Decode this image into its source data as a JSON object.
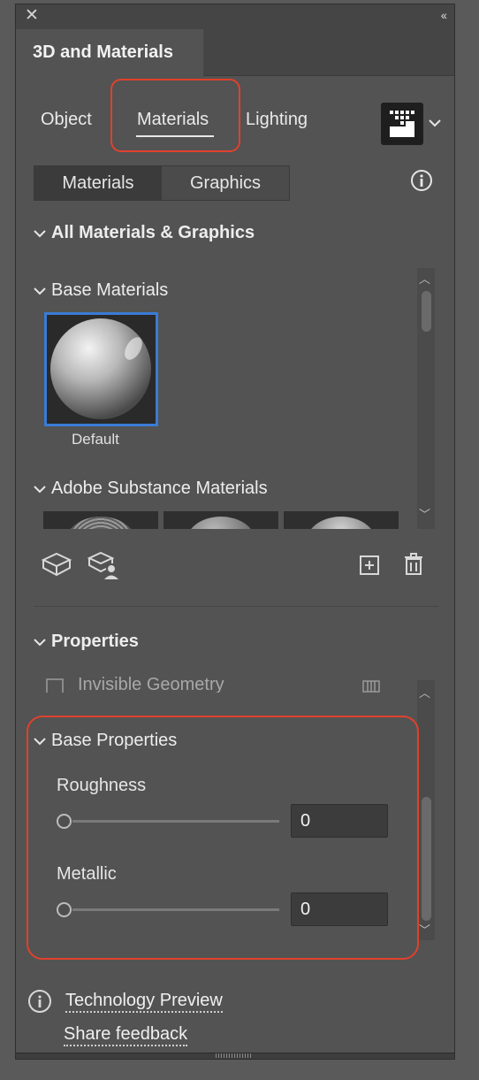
{
  "window": {
    "title": "3D and Materials"
  },
  "tabs": [
    {
      "label": "Object"
    },
    {
      "label": "Materials"
    },
    {
      "label": "Lighting"
    }
  ],
  "toggle": {
    "materials": "Materials",
    "graphics": "Graphics"
  },
  "sections": {
    "all": "All Materials & Graphics",
    "base_materials": "Base Materials",
    "substance": "Adobe Substance Materials",
    "properties": "Properties",
    "invisible_geometry": "Invisible Geometry",
    "base_properties": "Base Properties"
  },
  "materials": {
    "selected_label": "Default"
  },
  "props": {
    "roughness_label": "Roughness",
    "roughness_value": "0",
    "metallic_label": "Metallic",
    "metallic_value": "0"
  },
  "footer": {
    "tech_preview": "Technology Preview",
    "feedback": "Share feedback"
  },
  "colors": {
    "accent_highlight": "#e0412c",
    "selection": "#3a7bd5",
    "panel_bg": "#535353"
  }
}
